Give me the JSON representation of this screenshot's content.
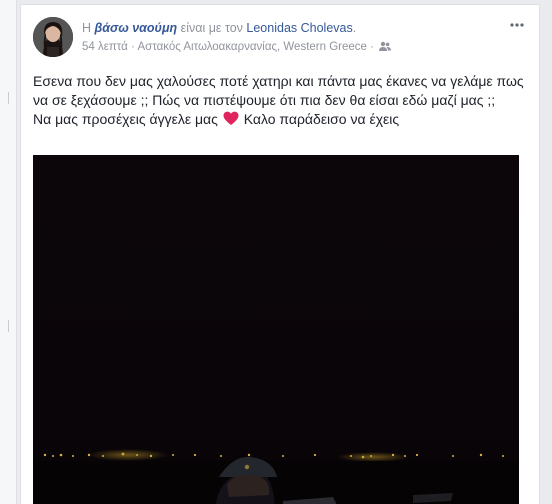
{
  "post": {
    "prefix": "Η",
    "author": "βάσω ναούμη",
    "with_text": "είναι με τον",
    "tagged": "Leonidas Cholevas",
    "period": ".",
    "time": "54 λεπτά",
    "separator": "·",
    "location": "Αστακός Αιτωλοακαρνανίας, Western Greece",
    "separator2": "·",
    "more_label": "•••",
    "line1": "Εσενα που δεν μας χαλούσες ποτέ χατηρι και πάντα μας έκανες να γελάμε πως να σε ξεχάσουμε ;; Πώς να πιστέψουμε ότι πια δεν θα είσαι εδώ μαζί μας ;;",
    "line2a": "Να μας προσέχεις άγγελε μας",
    "line2b": "Καλο παράδεισο να έχεις"
  },
  "colors": {
    "link": "#365899",
    "muted": "#90949c",
    "text": "#1d2129",
    "heart": "#e0245e",
    "photo_bg": "#0a0508"
  },
  "icons": {
    "more": "more-options-icon",
    "audience": "friends-audience-icon",
    "reaction": "heart-emoji-icon"
  }
}
